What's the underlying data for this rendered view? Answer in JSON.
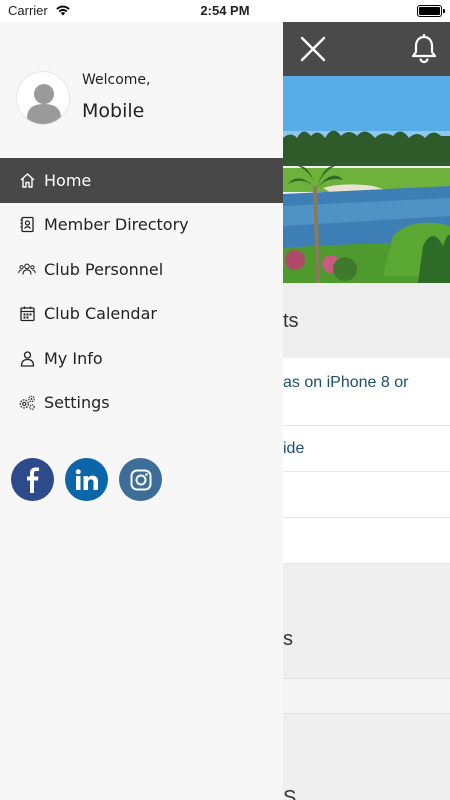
{
  "status_bar": {
    "carrier": "Carrier",
    "time": "2:54 PM",
    "battery_level": 1.0
  },
  "drawer": {
    "welcome": "Welcome,",
    "username": "Mobile",
    "nav": [
      {
        "label": "Home",
        "icon": "home-icon",
        "active": true
      },
      {
        "label": "Member Directory",
        "icon": "contact-book-icon"
      },
      {
        "label": "Club Personnel",
        "icon": "people-icon"
      },
      {
        "label": "Club Calendar",
        "icon": "calendar-icon"
      },
      {
        "label": "My Info",
        "icon": "person-icon"
      },
      {
        "label": "Settings",
        "icon": "gears-icon"
      }
    ],
    "socials": [
      "facebook-icon",
      "linkedin-icon",
      "instagram-icon"
    ]
  },
  "background": {
    "section1_title": "ts",
    "news": [
      "as on iPhone 8 or",
      "ide"
    ],
    "section2_title": "s",
    "section3_title": "S"
  },
  "colors": {
    "header": "#4a4a4a",
    "active_nav": "#484848",
    "link": "#1a4f75"
  }
}
